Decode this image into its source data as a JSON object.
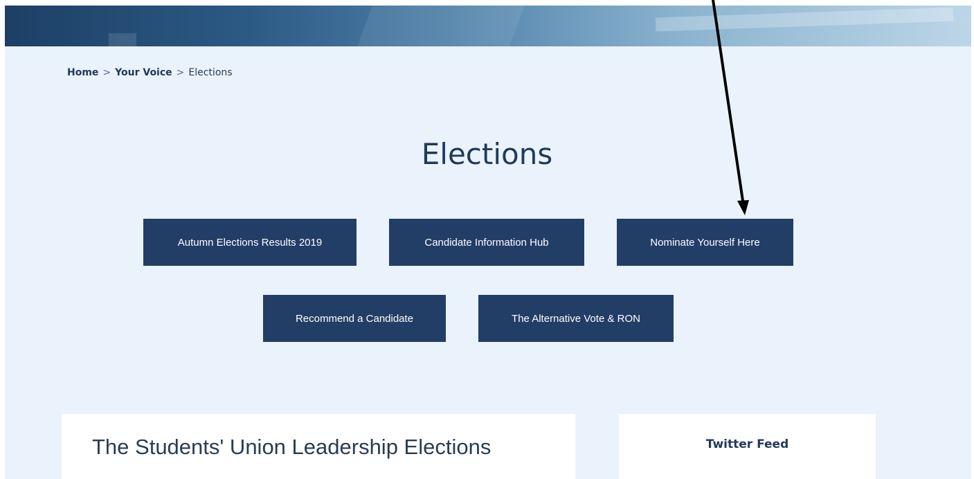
{
  "breadcrumb": {
    "home": "Home",
    "sep1": ">",
    "your_voice": "Your Voice",
    "sep2": ">",
    "current": "Elections"
  },
  "page_title": "Elections",
  "buttons": [
    {
      "label": "Autumn Elections Results 2019"
    },
    {
      "label": "Candidate Information Hub"
    },
    {
      "label": "Nominate Yourself Here"
    },
    {
      "label": "Recommend a Candidate"
    },
    {
      "label": "The Alternative Vote & RON"
    }
  ],
  "main_card": {
    "heading": "The Students' Union Leadership Elections"
  },
  "side_card": {
    "heading": "Twitter Feed"
  },
  "colors": {
    "button_bg": "#233e66",
    "page_bg": "#eaf3fb",
    "title": "#22395b"
  }
}
